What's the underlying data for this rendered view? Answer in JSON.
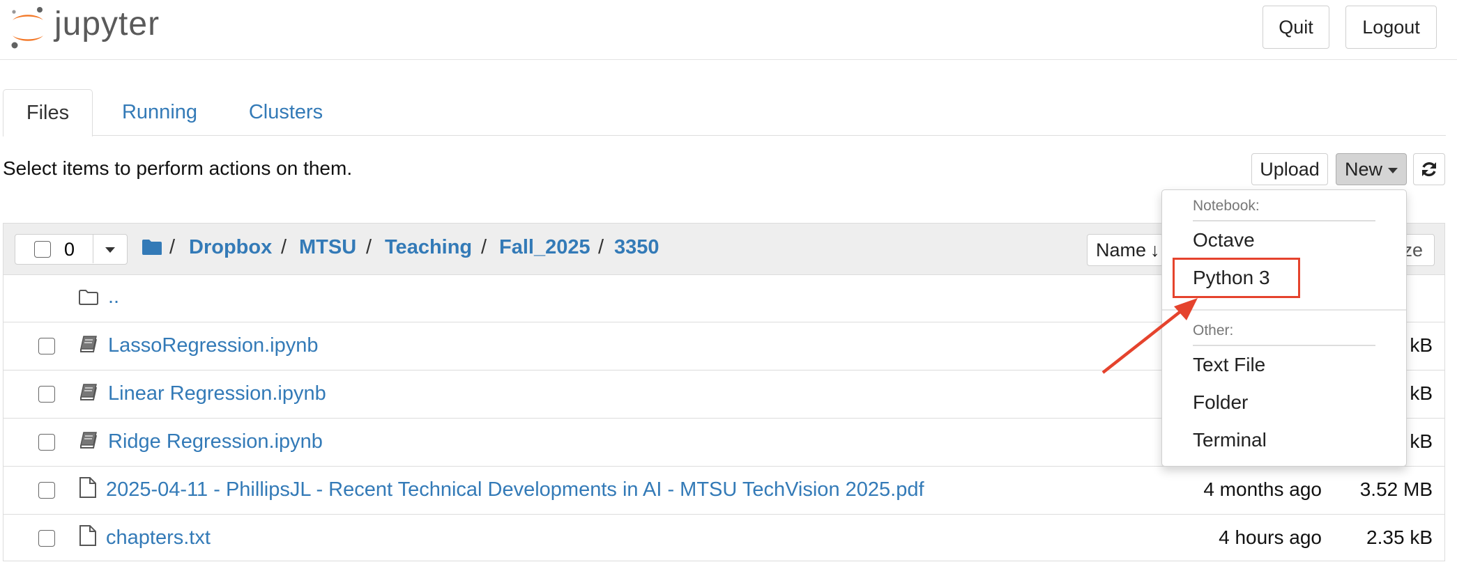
{
  "app": {
    "logo_text": "jupyter",
    "quit_label": "Quit",
    "logout_label": "Logout"
  },
  "tabs": [
    {
      "label": "Files",
      "active": true
    },
    {
      "label": "Running",
      "active": false
    },
    {
      "label": "Clusters",
      "active": false
    }
  ],
  "toolbar": {
    "hint": "Select items to perform actions on them.",
    "upload_label": "Upload",
    "new_label": "New",
    "refresh_icon": "refresh-icon"
  },
  "list_header": {
    "selected_count": "0",
    "breadcrumb": [
      "Dropbox",
      "MTSU",
      "Teaching",
      "Fall_2025",
      "3350"
    ],
    "sort_label": "Name",
    "size_label_partial": "ze"
  },
  "files": [
    {
      "name": "..",
      "type": "folder",
      "modified": "",
      "size": ""
    },
    {
      "name": "LassoRegression.ipynb",
      "type": "notebook",
      "modified": "",
      "size": "kB"
    },
    {
      "name": "Linear Regression.ipynb",
      "type": "notebook",
      "modified": "",
      "size": "kB"
    },
    {
      "name": "Ridge Regression.ipynb",
      "type": "notebook",
      "modified": "",
      "size": "kB"
    },
    {
      "name": "2025-04-11 - PhillipsJL - Recent Technical Developments in AI - MTSU TechVision 2025.pdf",
      "type": "file",
      "modified": "4 months ago",
      "size": "3.52 MB"
    },
    {
      "name": "chapters.txt",
      "type": "file",
      "modified": "4 hours ago",
      "size": "2.35 kB"
    }
  ],
  "new_menu": {
    "notebook_header": "Notebook:",
    "notebook_items": [
      "Octave",
      "Python 3"
    ],
    "other_header": "Other:",
    "other_items": [
      "Text File",
      "Folder",
      "Terminal"
    ],
    "highlighted_item": "Python 3"
  },
  "colors": {
    "link": "#337ab7",
    "logo_orange": "#f37726",
    "annotation": "#e5432d",
    "header_bg": "#eeeeee"
  }
}
